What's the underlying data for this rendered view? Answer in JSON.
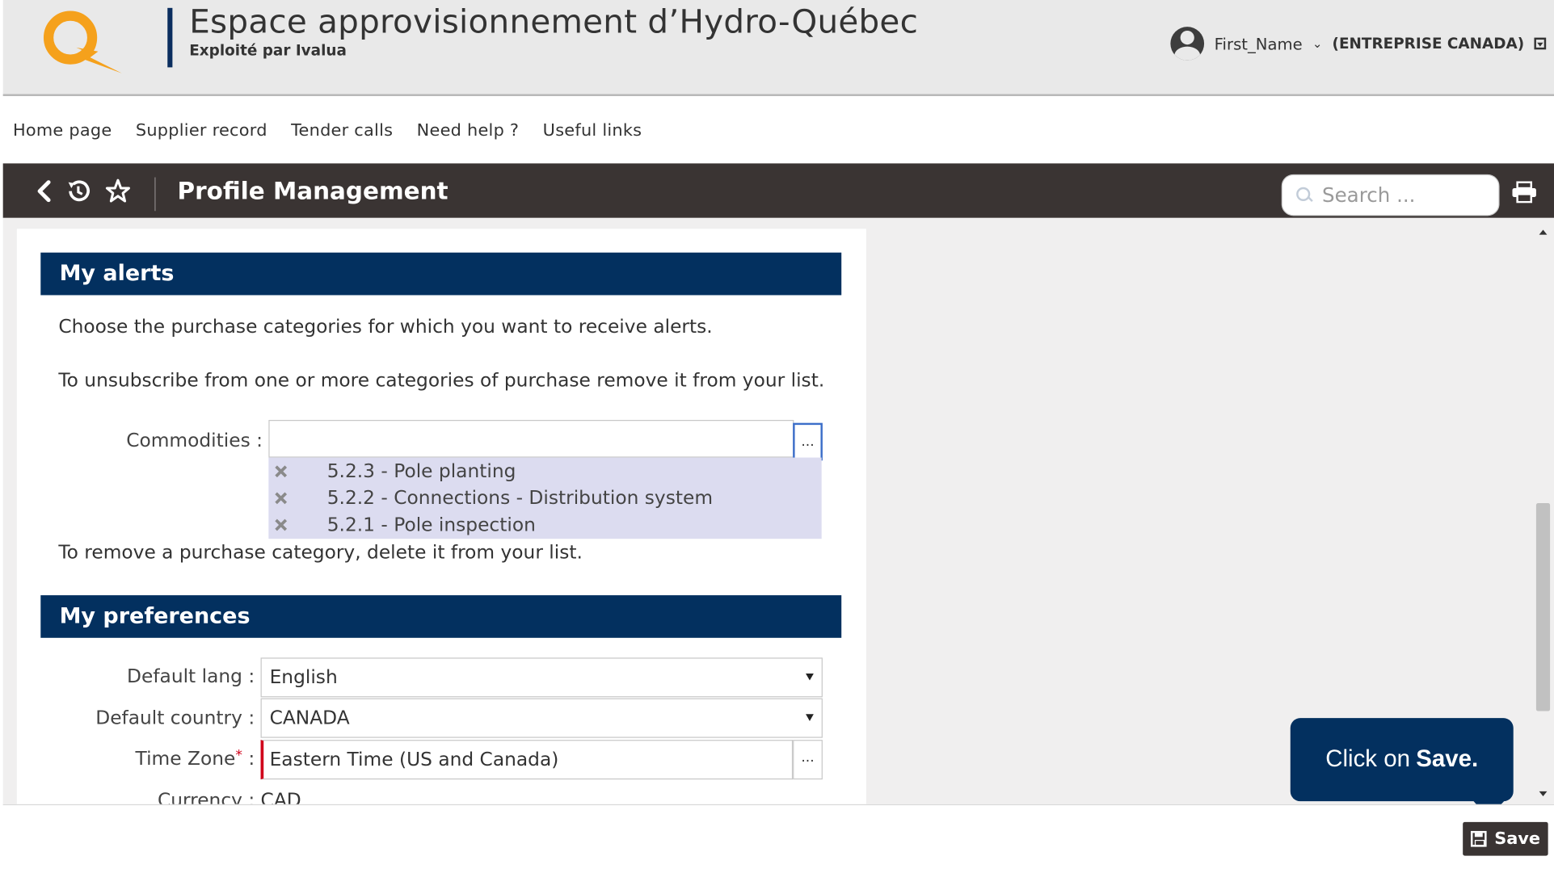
{
  "header": {
    "title": "Espace approvisionnement d’Hydro-Québec",
    "subtitle": "Exploité par Ivalua",
    "user_name": "First_Name",
    "company": "(ENTREPRISE CANADA)"
  },
  "nav": {
    "items": [
      "Home page",
      "Supplier record",
      "Tender calls",
      "Need help ?",
      "Useful links"
    ]
  },
  "toolbar": {
    "page_title": "Profile Management",
    "search_placeholder": "Search ..."
  },
  "alerts": {
    "section_title": "My alerts",
    "intro_1": "Choose the purchase categories for which you want to receive alerts.",
    "intro_2": "To unsubscribe from one or more categories of purchase remove it from your list.",
    "commodities_label": "Commodities :",
    "dots": "...",
    "commodities": [
      "5.2.3 - Pole planting",
      "5.2.2 - Connections - Distribution system",
      "5.2.1 - Pole inspection"
    ],
    "remove_hint": "To remove a purchase category, delete it from your list."
  },
  "preferences": {
    "section_title": "My preferences",
    "lang_label": "Default lang :",
    "lang_value": "English",
    "country_label": "Default country :",
    "country_value": "CANADA",
    "tz_label": "Time Zone",
    "tz_required": "*",
    "tz_colon": " :",
    "tz_value": "Eastern Time (US and Canada)",
    "tz_dots": "...",
    "currency_label": "Currency :",
    "currency_value": "CAD"
  },
  "tooltip": {
    "text_prefix": "Click on",
    "text_bold": "Save."
  },
  "footer": {
    "save_label": "Save"
  },
  "colors": {
    "brand_navy": "#03305f",
    "toolbar_dark": "#3a3433",
    "logo_orange": "#f5a11c"
  }
}
